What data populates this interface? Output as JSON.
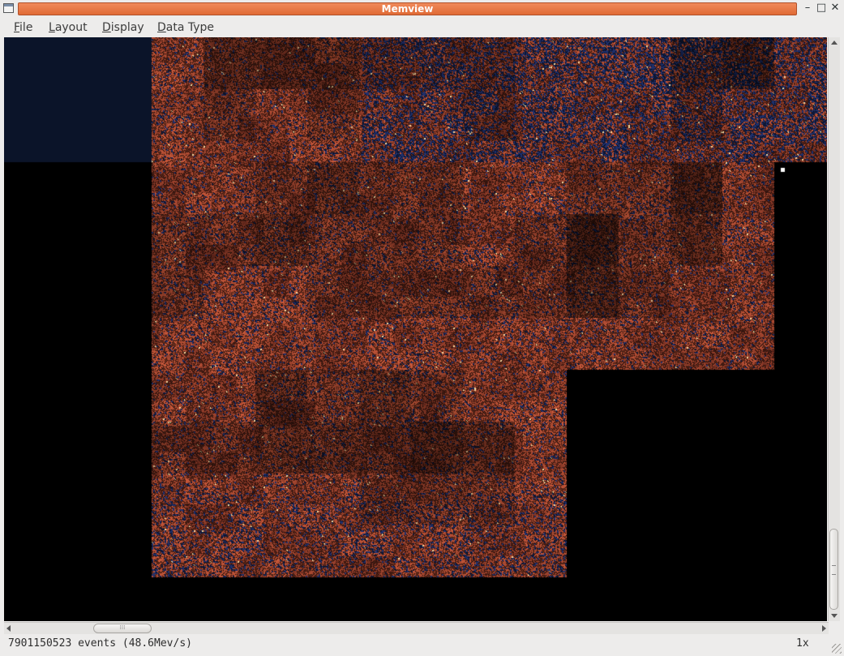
{
  "window": {
    "title": "Memview",
    "controls": {
      "minimize": "–",
      "maximize": "□",
      "close": "✕"
    }
  },
  "menu": {
    "items": [
      {
        "label": "File"
      },
      {
        "label": "Layout"
      },
      {
        "label": "Display"
      },
      {
        "label": "Data Type"
      }
    ]
  },
  "status": {
    "events_text": "7901150523 events (48.6Mev/s)",
    "zoom": "1x"
  },
  "colors": {
    "background": "#000000",
    "unused_region": "#0b1429",
    "memory_base": "#6b2a1e",
    "memory_hot": "#c8583a",
    "memory_peak": "#f2d8a0",
    "memory_cold": "#1e2f6a",
    "title_accent": "#e8703f"
  },
  "scroll": {
    "horizontal_thumb_glyph": "⁞⁞⁞"
  }
}
